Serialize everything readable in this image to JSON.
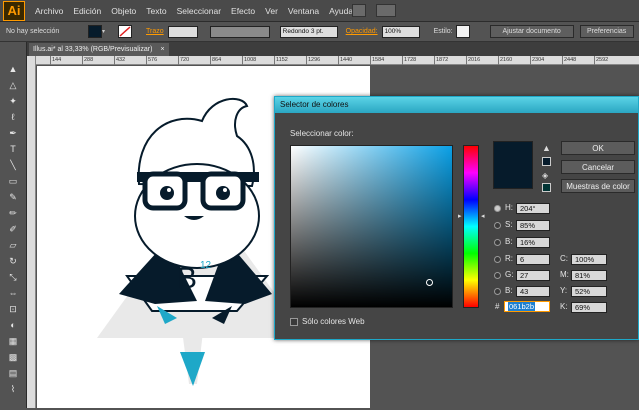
{
  "app": {
    "logo": "Ai"
  },
  "menu": [
    "Archivo",
    "Edición",
    "Objeto",
    "Texto",
    "Seleccionar",
    "Efecto",
    "Ver",
    "Ventana",
    "Ayuda"
  ],
  "control": {
    "selection_status": "No hay selección",
    "stroke_label": "Trazo",
    "brush": "Redondo 3 pt.",
    "opacity_label": "Opacidad:",
    "opacity_value": "100%",
    "style_label": "Estilo:",
    "adjust_doc": "Ajustar documento",
    "preferences": "Preferencias"
  },
  "document_tab": {
    "label": "Illus.ai* al 33,33% (RGB/Previsualizar)",
    "close": "×"
  },
  "ruler": [
    "144",
    "288",
    "432",
    "576",
    "720",
    "864",
    "1008",
    "1152",
    "1296",
    "1440",
    "1584",
    "1728",
    "1872",
    "2016",
    "2160",
    "2304",
    "2448",
    "2592"
  ],
  "logo_text": {
    "letter": "B",
    "superscript": "12"
  },
  "dialog": {
    "title": "Selector de colores",
    "select_label": "Seleccionar color:",
    "ok": "OK",
    "cancel": "Cancelar",
    "swatches": "Muestras de color",
    "web_only": "Sólo colores Web",
    "hsb": {
      "h_label": "H:",
      "h_value": "204°",
      "s_label": "S:",
      "s_value": "85%",
      "b_label": "B:",
      "b_value": "16%"
    },
    "rgb": {
      "r_label": "R:",
      "r_value": "6",
      "g_label": "G:",
      "g_value": "27",
      "b_label": "B:",
      "b_value": "43"
    },
    "cmyk": {
      "c_label": "C:",
      "c_value": "100%",
      "m_label": "M:",
      "m_value": "81%",
      "y_label": "Y:",
      "y_value": "52%",
      "k_label": "K:",
      "k_value": "69%"
    },
    "hex_label": "#",
    "hex_value": "061b2b",
    "colors": {
      "current": "#061b2b",
      "accent": "#1ea8c8"
    }
  }
}
